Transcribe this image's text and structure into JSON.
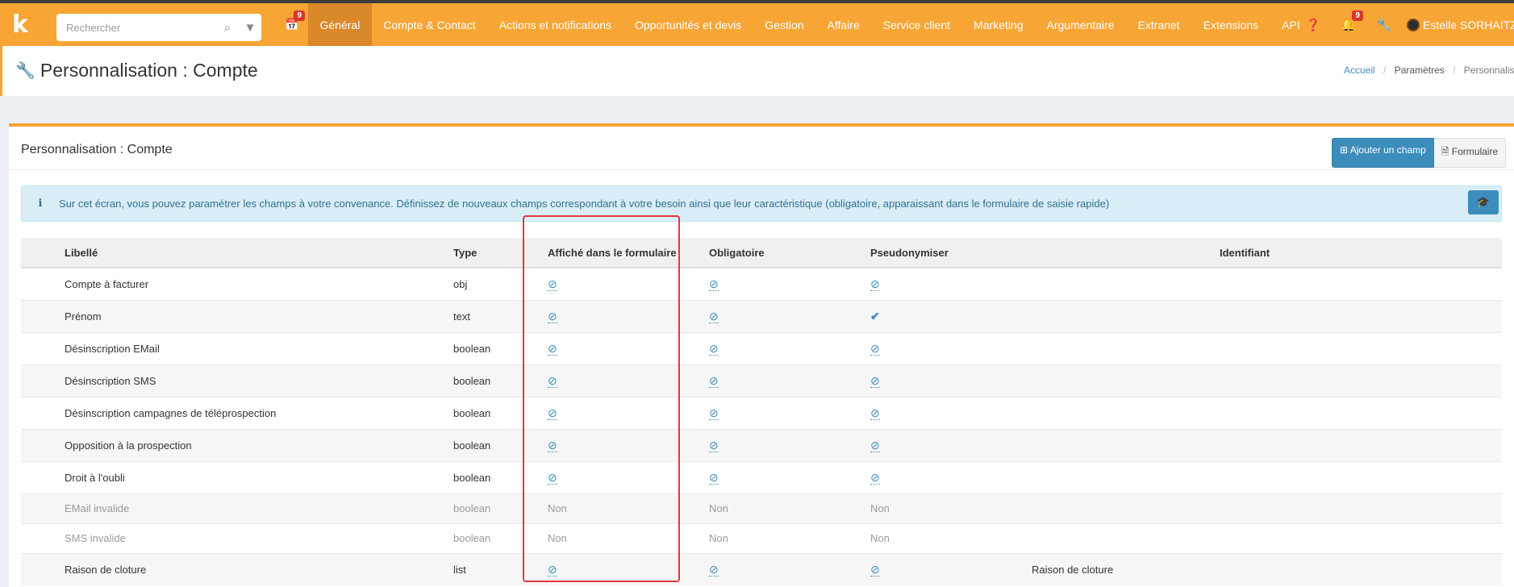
{
  "topbar": {
    "logo": "k",
    "search_placeholder": "Rechercher",
    "calendar_badge": "9",
    "nav": [
      "Général",
      "Compte & Contact",
      "Actions et notifications",
      "Opportunités et devis",
      "Gestion",
      "Affaire",
      "Service client",
      "Marketing",
      "Argumentaire",
      "Extranet",
      "Extensions",
      "API"
    ],
    "notif_badge": "9",
    "user_name": "Estelle SORHAITZ"
  },
  "header": {
    "title": "Personnalisation : Compte",
    "breadcrumb": [
      "Accueil",
      "Paramètres",
      "Personnalisation"
    ]
  },
  "panel": {
    "title": "Personnalisation : Compte",
    "add_button": "Ajouter un champ",
    "form_button": "Formulaire",
    "info_text": "Sur cet écran, vous pouvez paramétrer les champs à votre convenance. Définissez de nouveaux champs correspondant à votre besoin ainsi que leur caractéristique (obligatoire, apparaissant dans le formulaire de saisie rapide)"
  },
  "table": {
    "headers": [
      "Libellé",
      "Type",
      "Affiché dans le formulaire",
      "Obligatoire",
      "Pseudonymiser",
      "Identifiant"
    ],
    "rows": [
      {
        "label": "Compte à facturer",
        "type": "obj",
        "form": "ban",
        "required": "ban",
        "pseudo": "ban",
        "ident": "",
        "disabled": false
      },
      {
        "label": "Prénom",
        "type": "text",
        "form": "ban",
        "required": "ban",
        "pseudo": "check",
        "ident": "",
        "disabled": false
      },
      {
        "label": "Désinscription EMail",
        "type": "boolean",
        "form": "ban",
        "required": "ban",
        "pseudo": "ban",
        "ident": "",
        "disabled": false
      },
      {
        "label": "Désinscription SMS",
        "type": "boolean",
        "form": "ban",
        "required": "ban",
        "pseudo": "ban",
        "ident": "",
        "disabled": false
      },
      {
        "label": "Désinscription campagnes de téléprospection",
        "type": "boolean",
        "form": "ban",
        "required": "ban",
        "pseudo": "ban",
        "ident": "",
        "disabled": false
      },
      {
        "label": "Opposition à la prospection",
        "type": "boolean",
        "form": "ban",
        "required": "ban",
        "pseudo": "ban",
        "ident": "",
        "disabled": false
      },
      {
        "label": "Droit à l'oubli",
        "type": "boolean",
        "form": "ban",
        "required": "ban",
        "pseudo": "ban",
        "ident": "",
        "disabled": false
      },
      {
        "label": "EMail invalide",
        "type": "boolean",
        "form": "Non",
        "required": "Non",
        "pseudo": "Non",
        "ident": "",
        "disabled": true
      },
      {
        "label": "SMS invalide",
        "type": "boolean",
        "form": "Non",
        "required": "Non",
        "pseudo": "Non",
        "ident": "",
        "disabled": true
      },
      {
        "label": "Raison de cloture",
        "type": "list",
        "form": "ban",
        "required": "ban",
        "pseudo": "ban",
        "ident": "Raison de cloture",
        "disabled": false
      }
    ]
  },
  "colors": {
    "brand": "#f7a535",
    "accent": "#3c8dbc",
    "highlight": "#e03a3a"
  }
}
